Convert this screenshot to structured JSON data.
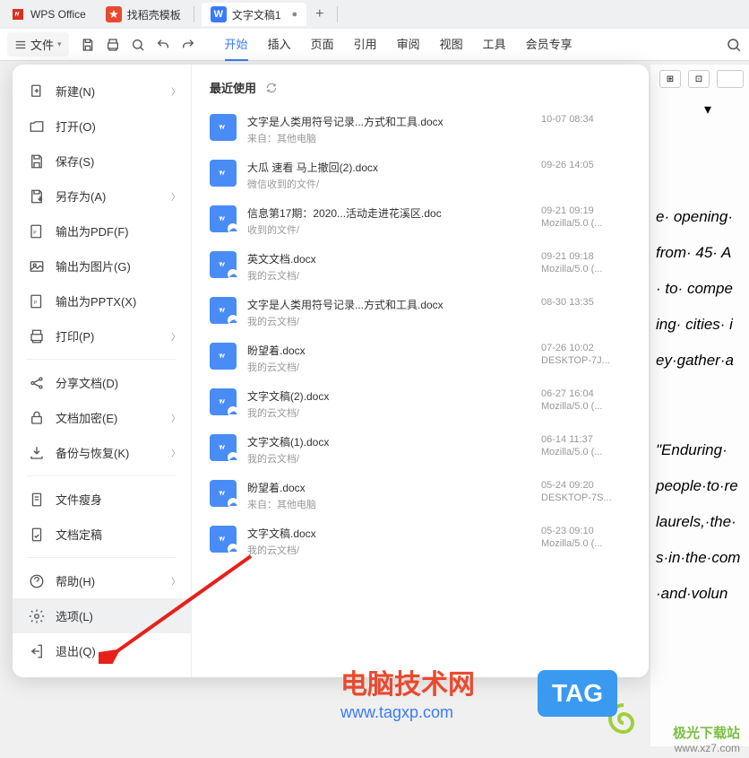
{
  "titlebar": {
    "app": "WPS Office",
    "tabs": [
      {
        "icon_bg": "#e94a2f",
        "icon_text": "",
        "label": "找稻壳模板"
      },
      {
        "icon_bg": "#3a7afe",
        "icon_text": "W",
        "label": "文字文稿1",
        "active": true,
        "modified": "●"
      }
    ],
    "plus": "+"
  },
  "menubar": {
    "file": "文件",
    "tabs": [
      "开始",
      "插入",
      "页面",
      "引用",
      "审阅",
      "视图",
      "工具",
      "会员专享"
    ],
    "active": "开始"
  },
  "file_menu": [
    {
      "icon": "new",
      "label": "新建(N)",
      "chevron": true
    },
    {
      "icon": "open",
      "label": "打开(O)"
    },
    {
      "icon": "save",
      "label": "保存(S)"
    },
    {
      "icon": "saveas",
      "label": "另存为(A)",
      "chevron": true
    },
    {
      "icon": "pdf",
      "label": "输出为PDF(F)"
    },
    {
      "icon": "image",
      "label": "输出为图片(G)"
    },
    {
      "icon": "pptx",
      "label": "输出为PPTX(X)"
    },
    {
      "icon": "print",
      "label": "打印(P)",
      "chevron": true
    },
    {
      "divider": true
    },
    {
      "icon": "share",
      "label": "分享文档(D)"
    },
    {
      "icon": "encrypt",
      "label": "文档加密(E)",
      "chevron": true
    },
    {
      "icon": "backup",
      "label": "备份与恢复(K)",
      "chevron": true
    },
    {
      "divider": true
    },
    {
      "icon": "slim",
      "label": "文件瘦身"
    },
    {
      "icon": "finalize",
      "label": "文档定稿"
    },
    {
      "divider": true
    },
    {
      "icon": "help",
      "label": "帮助(H)",
      "chevron": true
    },
    {
      "icon": "options",
      "label": "选项(L)",
      "highlighted": true
    },
    {
      "icon": "exit",
      "label": "退出(Q)"
    }
  ],
  "recent": {
    "header": "最近使用",
    "items": [
      {
        "name": "文字是人类用符号记录...方式和工具.docx",
        "source": "来自：其他电脑",
        "date": "10-07 08:34",
        "client": ""
      },
      {
        "name": "大瓜 速看 马上撤回(2).docx",
        "source": "微信收到的文件/",
        "date": "09-26 14:05",
        "client": ""
      },
      {
        "name": "信息第17期：2020...活动走进花溪区.doc",
        "source": "收到的文件/",
        "date": "09-21 09:19",
        "client": "Mozilla/5.0 (...",
        "cloud": true
      },
      {
        "name": "英文文档.docx",
        "source": "我的云文档/",
        "date": "09-21 09:18",
        "client": "Mozilla/5.0 (...",
        "cloud": true
      },
      {
        "name": "文字是人类用符号记录...方式和工具.docx",
        "source": "我的云文档/",
        "date": "08-30 13:35",
        "client": "",
        "cloud": true
      },
      {
        "name": "盼望着.docx",
        "source": "我的云文档/",
        "date": "07-26 10:02",
        "client": "DESKTOP-7J..."
      },
      {
        "name": "文字文稿(2).docx",
        "source": "我的云文档/",
        "date": "06-27 16:04",
        "client": "Mozilla/5.0 (...",
        "cloud": true
      },
      {
        "name": "文字文稿(1).docx",
        "source": "我的云文档/",
        "date": "06-14 11:37",
        "client": "Mozilla/5.0 (...",
        "cloud": true
      },
      {
        "name": "盼望着.docx",
        "source": "来自：其他电脑",
        "date": "05-24 09:20",
        "client": "DESKTOP-7S...",
        "cloud": true
      },
      {
        "name": "文字文稿.docx",
        "source": "我的云文档/",
        "date": "05-23 09:10",
        "client": "Mozilla/5.0 (...",
        "cloud": true
      }
    ]
  },
  "doc_lines": [
    "e· opening·",
    "from· 45· A",
    "· to· compe",
    "ing· cities· i",
    "ey·gather·a",
    "",
    "\"Enduring·",
    "people·to·re",
    "laurels,·the·",
    "s·in·the·com",
    "·and·volun"
  ],
  "watermarks": {
    "w1_text": "电脑技术网",
    "w1_url": "www.tagxp.com",
    "tag": "TAG",
    "w2_text": "极光下载站",
    "w2_url": "www.xz7.com"
  }
}
